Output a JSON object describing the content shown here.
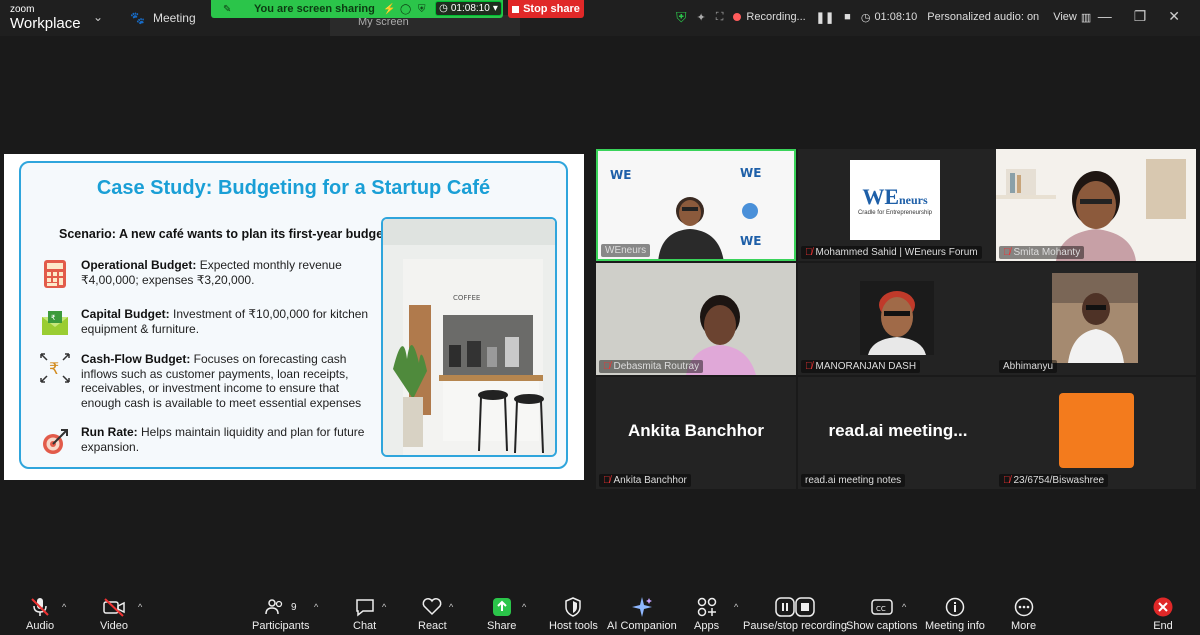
{
  "app": {
    "brand_line1": "zoom",
    "brand_line2": "Workplace",
    "meeting_label": "Meeting"
  },
  "share_banner": {
    "text": "You are screen sharing",
    "timer": "01:08:10",
    "stop_label": "Stop share",
    "screen_tab": "My screen"
  },
  "top_right": {
    "recording_label": "Recording...",
    "timer": "01:08:10",
    "audio_label": "Personalized audio: on",
    "view_label": "View"
  },
  "slide": {
    "title": "Case Study: Budgeting for a Startup Café",
    "scenario": "Scenario: A new café wants to plan its first-year budget.",
    "items": [
      {
        "heading": "Operational Budget:",
        "body": "Expected monthly revenue ₹4,00,000; expenses ₹3,20,000.",
        "icon": "calculator-icon"
      },
      {
        "heading": "Capital Budget:",
        "body": "Investment of ₹10,00,000 for kitchen equipment & furniture.",
        "icon": "money-envelope-icon"
      },
      {
        "heading": "Cash-Flow Budget:",
        "body": "Focuses on forecasting cash inflows such as customer payments, loan receipts, receivables, or investment income to ensure that enough cash is available to meet essential expenses",
        "icon": "rupee-flow-icon"
      },
      {
        "heading": "Run Rate:",
        "body": "Helps maintain liquidity and plan for future expansion.",
        "icon": "target-growth-icon"
      }
    ],
    "photo_sign": "COFFEE"
  },
  "participants_grid": [
    {
      "name": "WEneurs",
      "muted": false,
      "active": true
    },
    {
      "name": "Mohammed Sahid | WEneurs Forum",
      "muted": true
    },
    {
      "name": "Smita Mohanty",
      "muted": true
    },
    {
      "name": "Debasmita Routray",
      "muted": true
    },
    {
      "name": "MANORANJAN DASH",
      "muted": true
    },
    {
      "name": "Abhimanyu",
      "muted": false
    },
    {
      "name": "Ankita Banchhor",
      "muted": true,
      "big_name": "Ankita Banchhor"
    },
    {
      "name": "read.ai meeting notes",
      "muted": false,
      "big_name": "read.ai  meeting..."
    },
    {
      "name": "23/6754/Biswashree",
      "muted": true
    }
  ],
  "logo_text": {
    "we": "WE",
    "neurs": "neurs",
    "tagline": "Cradle for Entrepreneurship"
  },
  "toolbar": {
    "audio": "Audio",
    "video": "Video",
    "participants": "Participants",
    "participants_count": "9",
    "chat": "Chat",
    "react": "React",
    "share": "Share",
    "host_tools": "Host tools",
    "ai_companion": "AI Companion",
    "apps": "Apps",
    "pause_stop": "Pause/stop recording",
    "captions": "Show captions",
    "meeting_info": "Meeting info",
    "more": "More",
    "end": "End"
  },
  "colors": {
    "accent": "#1a9fd6",
    "share_green": "#2bc54a",
    "stop_red": "#e02828",
    "end_red": "#e02828",
    "active_border": "#3ad35a"
  }
}
